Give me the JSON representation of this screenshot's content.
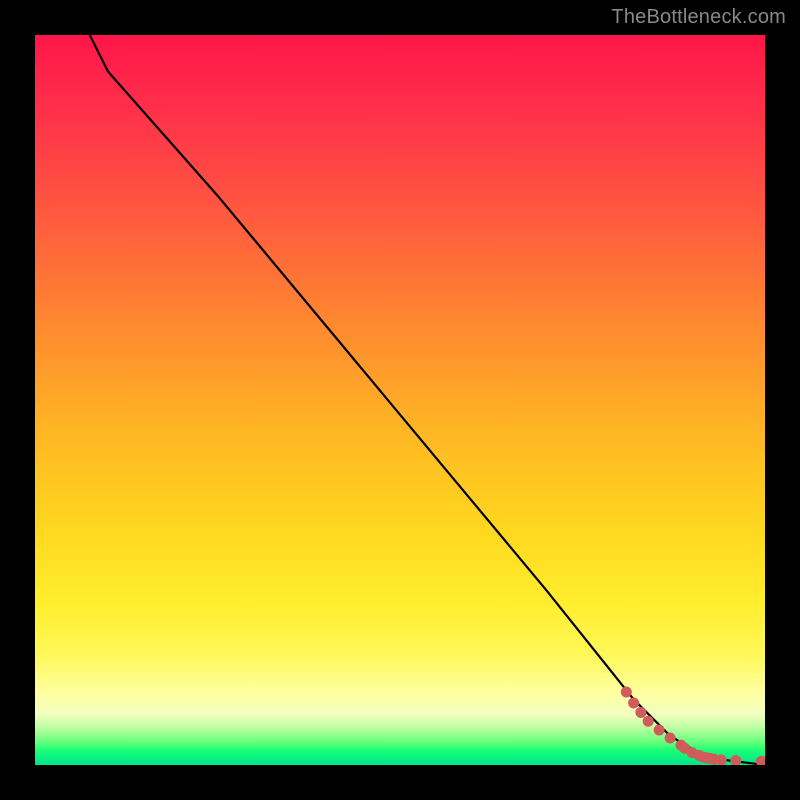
{
  "watermark": "TheBottleneck.com",
  "chart_data": {
    "type": "line",
    "title": "",
    "xlabel": "",
    "ylabel": "",
    "xlim": [
      0,
      100
    ],
    "ylim": [
      0,
      100
    ],
    "grid": false,
    "legend": false,
    "curve": {
      "x": [
        0,
        10,
        25,
        40,
        55,
        70,
        82,
        87,
        92,
        100
      ],
      "y": [
        115,
        95,
        78,
        60,
        42,
        24,
        9,
        4,
        1,
        0
      ]
    },
    "points": {
      "x": [
        81,
        82,
        83,
        84,
        85.5,
        87,
        88.5,
        89,
        90,
        91,
        91.5,
        92,
        92.5,
        93,
        94,
        96,
        99.5
      ],
      "y": [
        10,
        8.5,
        7.2,
        6,
        4.8,
        3.7,
        2.7,
        2.3,
        1.7,
        1.3,
        1.1,
        1.0,
        0.9,
        0.8,
        0.7,
        0.6,
        0.5
      ],
      "color": "#cf5b5b"
    },
    "background_gradient": {
      "direction": "vertical",
      "stops": [
        {
          "pos": 0.0,
          "color": "#ff1648"
        },
        {
          "pos": 0.55,
          "color": "#ffd81f"
        },
        {
          "pos": 0.9,
          "color": "#ffff9e"
        },
        {
          "pos": 1.0,
          "color": "#00e48a"
        }
      ]
    }
  }
}
